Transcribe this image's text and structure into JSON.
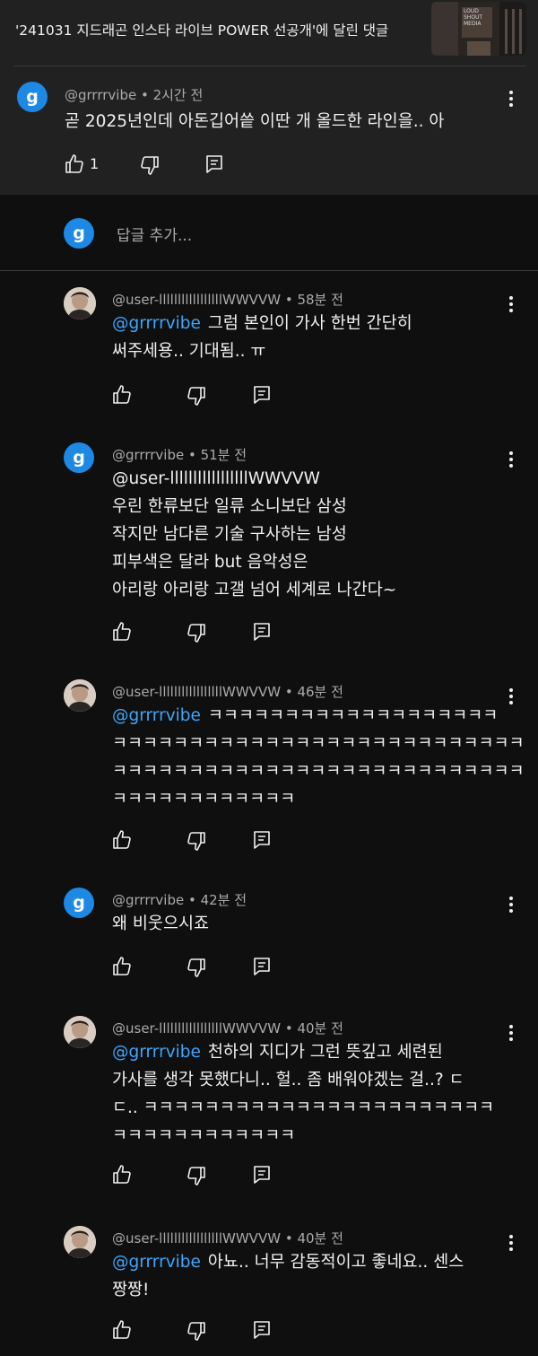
{
  "header": {
    "title": "'241031 지드래곤 인스타 라이브 POWER 선공개'에 달린 댓글",
    "thumbnail_text": "LOUD\nSHOUT\nMEDIA"
  },
  "parent": {
    "avatar_letter": "g",
    "author": "@grrrrvibe",
    "time": "2시간 전",
    "text": "곧 2025년인데 아돈깁어씉 이딴 개 올드한 라인을.. 아",
    "like_count": "1"
  },
  "reply_bar": {
    "avatar_letter": "g",
    "placeholder": "답글 추가..."
  },
  "replies": [
    {
      "avatar": "user",
      "author": "@user-lllllllllllllllllWWVVW",
      "time": "58분 전",
      "mention": "@grrrrvibe",
      "lines": [
        "그럼 본인이 가사 한번 간단히",
        "써주세용.. 기대됨.. ㅠ"
      ]
    },
    {
      "avatar": "g",
      "author": "@grrrrvibe",
      "time": "51분 전",
      "mention": "",
      "lines": [
        "@user-lllllllllllllllllWWVVW",
        "우린 한류보단 일류 소니보단 삼성",
        "작지만 남다른 기술 구사하는 남성",
        "피부색은 달라 but 음악성은",
        "아리랑 아리랑 고갤 넘어 세계로 나간다~"
      ]
    },
    {
      "avatar": "user",
      "author": "@user-lllllllllllllllllWWVVW",
      "time": "46분 전",
      "mention": "@grrrrvibe",
      "lines": [
        "ㅋㅋㅋㅋㅋㅋㅋㅋㅋㅋㅋㅋㅋㅋㅋㅋㅋㅋㅋ",
        "ㅋㅋㅋㅋㅋㅋㅋㅋㅋㅋㅋㅋㅋㅋㅋㅋㅋㅋㅋㅋㅋㅋㅋㅋㅋㅋㅋ",
        "ㅋㅋㅋㅋㅋㅋㅋㅋㅋㅋㅋㅋㅋㅋㅋㅋㅋㅋㅋㅋㅋㅋㅋㅋㅋㅋㅋ",
        "ㅋㅋㅋㅋㅋㅋㅋㅋㅋㅋㅋㅋ"
      ]
    },
    {
      "avatar": "g",
      "author": "@grrrrvibe",
      "time": "42분 전",
      "mention": "",
      "lines": [
        "왜 비웃으시죠"
      ]
    },
    {
      "avatar": "user",
      "author": "@user-lllllllllllllllllWWVVW",
      "time": "40분 전",
      "mention": "@grrrrvibe",
      "lines": [
        "천하의 지디가 그런 뜻깊고 세련된",
        "가사를 생각 못했다니.. 헐.. 좀 배워야겠는 걸..? ㄷ",
        "ㄷ..  ㅋㅋㅋㅋㅋㅋㅋㅋㅋㅋㅋㅋㅋㅋㅋㅋㅋㅋㅋㅋㅋㅋㅋ",
        "ㅋㅋㅋㅋㅋㅋㅋㅋㅋㅋㅋㅋ"
      ]
    },
    {
      "avatar": "user",
      "author": "@user-lllllllllllllllllWWVVW",
      "time": "40분 전",
      "mention": "@grrrrvibe",
      "lines": [
        "아뇨.. 너무 감동적이고 좋네요.. 센스",
        "짱짱!"
      ]
    }
  ],
  "colors": {
    "background": "#0f0f0f",
    "header_background": "#212121",
    "mention": "#3ea6ff",
    "avatar_g": "#1e88e5",
    "secondary_text": "#aaaaaa"
  },
  "icons": {
    "like": "thumbs-up-icon",
    "dislike": "thumbs-down-icon",
    "reply": "reply-icon",
    "more": "more-vert-icon"
  }
}
